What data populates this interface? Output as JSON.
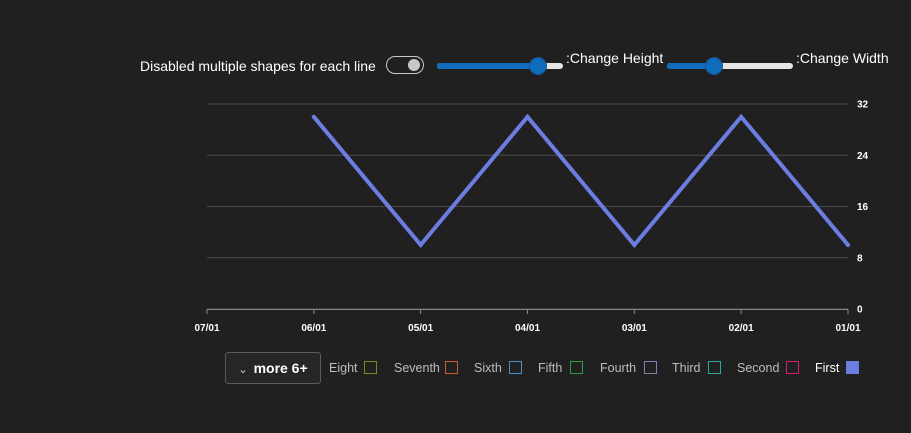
{
  "controls": {
    "toggle_label": "Disabled multiple shapes for each line",
    "toggle_on": true,
    "height_label": ":Change Height",
    "height_value": 0.8,
    "width_label": ":Change Width",
    "width_value": 0.37
  },
  "chart_data": {
    "type": "line",
    "title": "",
    "xlabel": "",
    "ylabel": "",
    "x_axis_reversed": true,
    "y_axis_position": "right",
    "x_ticks": [
      "07/01",
      "06/01",
      "05/01",
      "04/01",
      "03/01",
      "02/01",
      "01/01"
    ],
    "y_ticks": [
      "0",
      "8",
      "16",
      "24",
      "32"
    ],
    "ylim": [
      0,
      32
    ],
    "grid": true,
    "legend_position": "bottom",
    "series": [
      {
        "name": "First",
        "color": "#6b7de0",
        "points": [
          {
            "x": "06/01",
            "y": 30
          },
          {
            "x": "05/01",
            "y": 10
          },
          {
            "x": "04/01",
            "y": 30
          },
          {
            "x": "03/01",
            "y": 10
          },
          {
            "x": "02/01",
            "y": 30
          },
          {
            "x": "01/01",
            "y": 10
          }
        ]
      }
    ]
  },
  "legend": {
    "more_label": "more 6+",
    "items": [
      {
        "label": "Eight",
        "color": "#6b8e23",
        "active": false
      },
      {
        "label": "Seventh",
        "color": "#d05a2a",
        "active": false
      },
      {
        "label": "Sixth",
        "color": "#4a90c8",
        "active": false
      },
      {
        "label": "Fifth",
        "color": "#2e9e3a",
        "active": false
      },
      {
        "label": "Fourth",
        "color": "#8a7ab0",
        "active": false
      },
      {
        "label": "Third",
        "color": "#2aa8a8",
        "active": false
      },
      {
        "label": "Second",
        "color": "#d0207a",
        "active": false
      },
      {
        "label": "First",
        "color": "#6b7de0",
        "active": true
      }
    ]
  }
}
